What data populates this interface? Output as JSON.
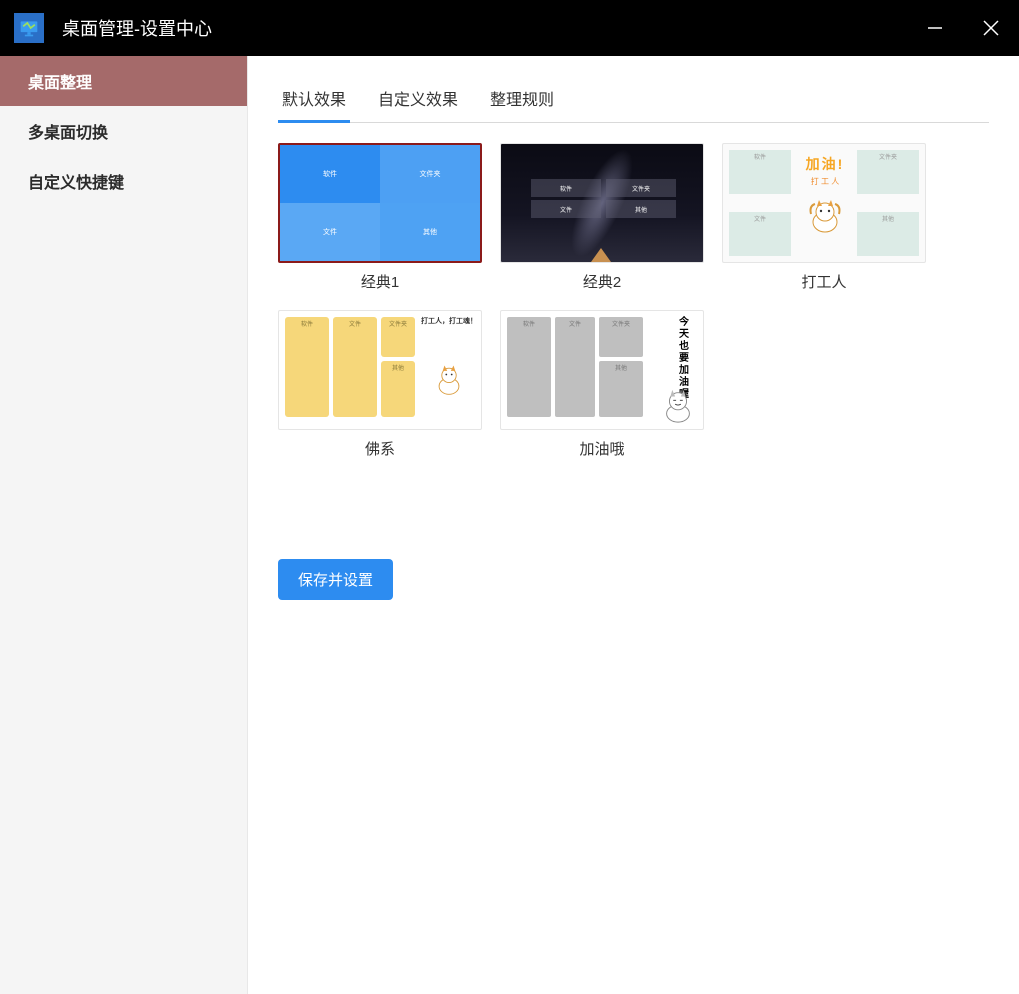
{
  "window": {
    "title": "桌面管理-设置中心"
  },
  "sidebar": {
    "items": [
      {
        "label": "桌面整理",
        "active": true
      },
      {
        "label": "多桌面切换",
        "active": false
      },
      {
        "label": "自定义快捷键",
        "active": false
      }
    ]
  },
  "tabs": [
    {
      "label": "默认效果",
      "active": true
    },
    {
      "label": "自定义效果",
      "active": false
    },
    {
      "label": "整理规则",
      "active": false
    }
  ],
  "themes": [
    {
      "label": "经典1",
      "selected": true,
      "tiles": [
        "软件",
        "文件夹",
        "文件",
        "其他"
      ]
    },
    {
      "label": "经典2",
      "selected": false,
      "tiles": [
        "软件",
        "文件夹",
        "文件",
        "其他"
      ]
    },
    {
      "label": "打工人",
      "selected": false,
      "tiles": [
        "软件",
        "文件夹",
        "文件",
        "其他"
      ],
      "center_text1": "加油!",
      "center_text2": "打 工 人"
    },
    {
      "label": "佛系",
      "selected": false,
      "tiles": [
        "软件",
        "文件",
        "文件夹",
        "其他"
      ],
      "banner": "打工人，打工魂！"
    },
    {
      "label": "加油哦",
      "selected": false,
      "tiles": [
        "软件",
        "文件",
        "文件夹",
        "其他"
      ],
      "vtext": "今天也要加油喔"
    }
  ],
  "buttons": {
    "save": "保存并设置"
  }
}
